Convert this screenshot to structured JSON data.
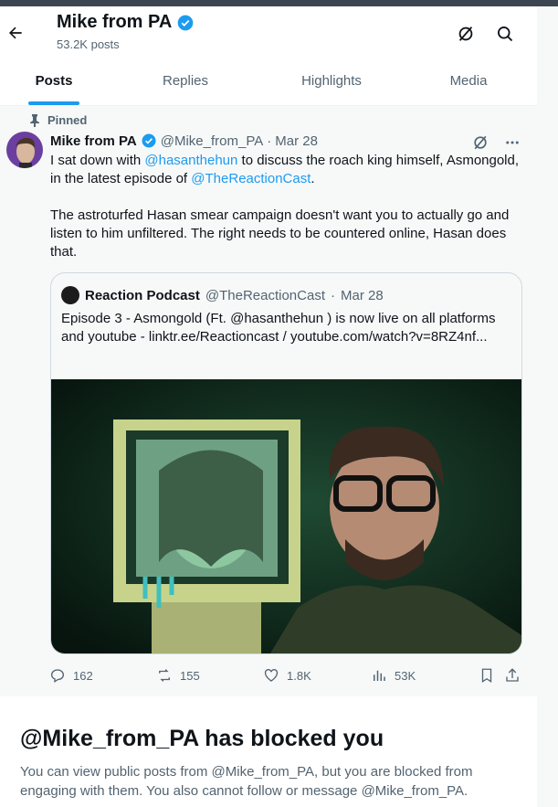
{
  "header": {
    "name": "Mike from PA",
    "posts_count": "53.2K posts"
  },
  "tabs": [
    {
      "label": "Posts",
      "active": true
    },
    {
      "label": "Replies",
      "active": false
    },
    {
      "label": "Highlights",
      "active": false
    },
    {
      "label": "Media",
      "active": false
    }
  ],
  "post": {
    "pinned_label": "Pinned",
    "author_name": "Mike from PA",
    "handle": "@Mike_from_PA",
    "sep": "·",
    "date": "Mar 28",
    "text1_a": "I sat down with ",
    "mention1": "@hasanthehun",
    "text1_b": " to discuss the roach king himself, Asmongold, in the latest episode of ",
    "mention2": "@TheReactionCast",
    "text1_c": ".",
    "text2": "The astroturfed Hasan smear campaign doesn't want you to actually go and listen to him unfiltered. The right needs to be countered online, Hasan does that.",
    "quote": {
      "name": "Reaction Podcast",
      "handle": "@TheReactionCast",
      "sep": "·",
      "date": "Mar 28",
      "text": "Episode 3 - Asmongold (Ft. @hasanthehun ) is now live on all platforms and youtube - linktr.ee/Reactioncast / youtube.com/watch?v=8RZ4nf..."
    },
    "actions": {
      "replies": "162",
      "reposts": "155",
      "likes": "1.8K",
      "views": "53K"
    }
  },
  "blocked": {
    "title": "@Mike_from_PA has blocked you",
    "text": "You can view public posts from @Mike_from_PA, but you are blocked from engaging with them. You also cannot follow or message @Mike_from_PA."
  },
  "colors": {
    "accent": "#1d9bf0",
    "text": "#0f1419",
    "muted": "#536471"
  }
}
